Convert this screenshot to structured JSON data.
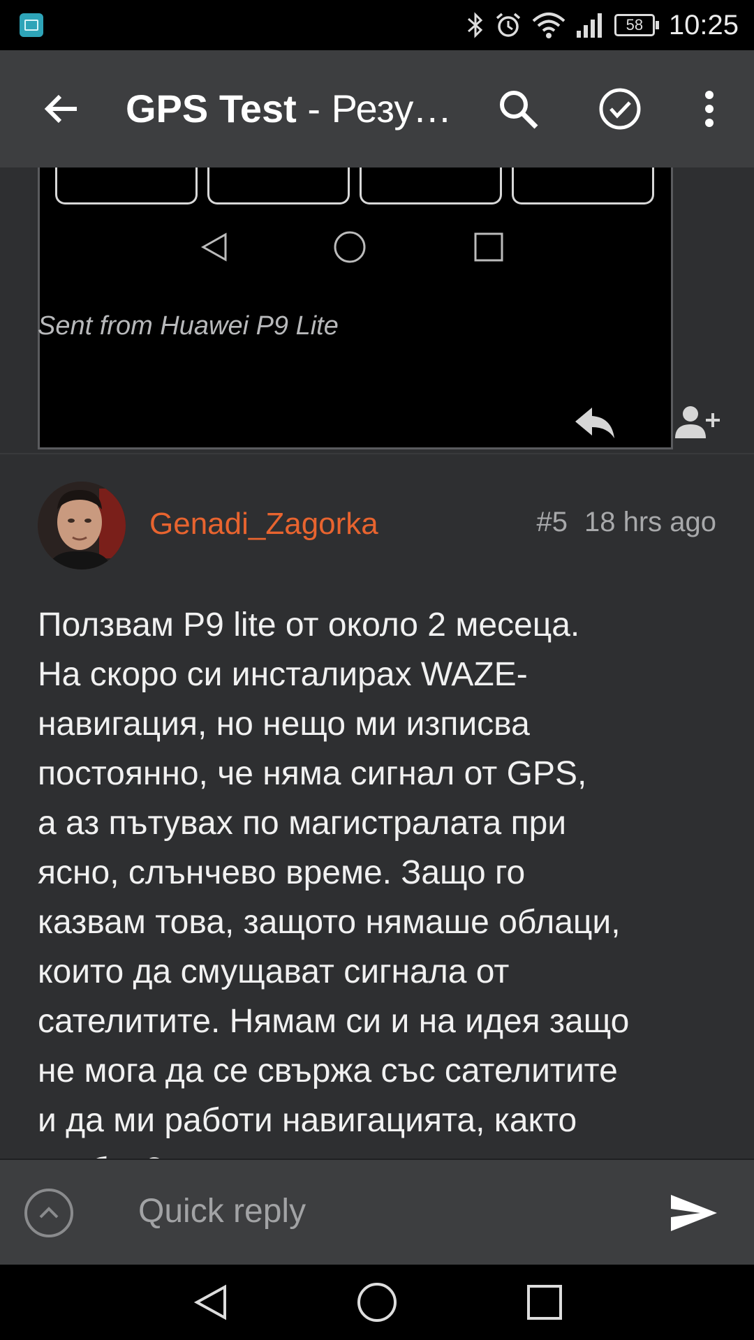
{
  "status_bar": {
    "time": "10:25",
    "battery": "58",
    "icons": [
      "gallery-notification-icon",
      "bluetooth-icon",
      "alarm-icon",
      "wifi-icon",
      "signal-icon",
      "battery-icon"
    ]
  },
  "app_bar": {
    "title_bold": "GPS Test",
    "title_rest": " - Резултати",
    "icons": [
      "back-arrow-icon",
      "search-icon",
      "check-circle-icon",
      "overflow-menu-icon"
    ]
  },
  "previous_post": {
    "signature": "Sent from Huawei P9 Lite",
    "actions": [
      "reply-icon",
      "add-person-icon"
    ]
  },
  "post": {
    "author": "Genadi_Zagorka",
    "number": "#5",
    "time": "18 hrs ago",
    "body_lines": [
      "Ползвам P9 lite от около 2 месеца.",
      "На скоро си инсталирах WAZE-",
      "навигация, но нещо ми изписва",
      "постоянно, че няма сигнал от GPS,",
      "а аз пътувах по магистралата при",
      "ясно, слънчево време. Защо го",
      "казвам това, защото нямаше облаци,",
      "които да смущават сигнала от",
      "сателитите. Нямам си и на идея защо",
      "не мога да се свържа със сателитите",
      "и да ми работи навигацията, както",
      "трябва?"
    ]
  },
  "quick_reply": {
    "placeholder": "Quick reply"
  },
  "colors": {
    "background": "#2e2f31",
    "app_bar": "#3d3e40",
    "author": "#e8642f"
  }
}
